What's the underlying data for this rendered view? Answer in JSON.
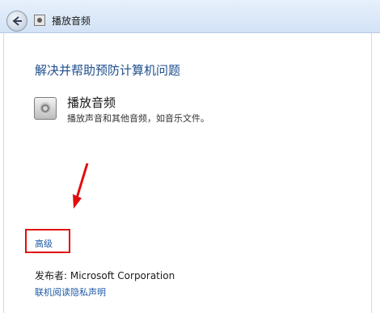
{
  "window": {
    "title": "播放音频"
  },
  "main": {
    "heading": "解决并帮助预防计算机问题",
    "item": {
      "title": "播放音频",
      "description": "播放声音和其他音频，如音乐文件。",
      "icon": "audio-speaker-icon"
    },
    "advanced_label": "高级",
    "publisher_label": "发布者: ",
    "publisher_name": "Microsoft Corporation",
    "privacy_label": "联机阅读隐私声明"
  },
  "colors": {
    "link": "#1e5aa8",
    "heading": "#1e4e8c",
    "annotation": "#e10d0d"
  }
}
